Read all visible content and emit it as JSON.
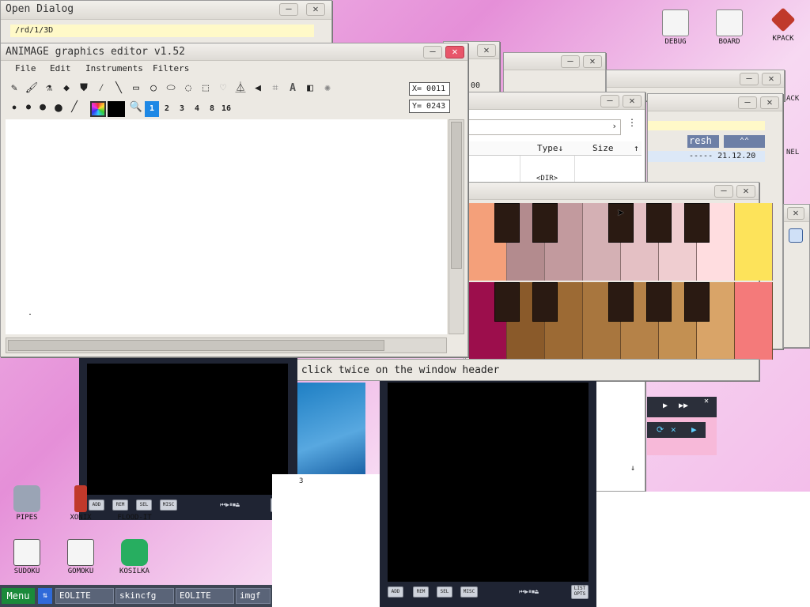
{
  "open_dialog": {
    "title": "Open Dialog",
    "path": "/rd/1/3D"
  },
  "animage": {
    "title": "ANIMAGE graphics editor v1.52",
    "menu": [
      "File",
      "Edit",
      "Instruments",
      "Filters"
    ],
    "x_coord": "X= 0011",
    "y_coord": "Y= 0243",
    "brush_sizes": [
      "1",
      "2",
      "3",
      "4",
      "8",
      "16"
    ],
    "selected_brush_size": "1"
  },
  "file_list": {
    "col_type": "Type",
    "col_size": "Size",
    "row_type": "<DIR>",
    "status_count": "3"
  },
  "right_panel": {
    "refresh_label": "resh",
    "date_text": "----- 21.12.20",
    "date_short": "2.20"
  },
  "piano": {
    "help_text": "To see help click twice on the window header",
    "top_row_colors": [
      "#f4a07a",
      "#b38b8e",
      "#c29a9e",
      "#d4b0b4",
      "#e4c0c4",
      "#efcdd0",
      "#ffdde0",
      "#fde35a"
    ],
    "bottom_row_colors": [
      "#9c0e4c",
      "#8a5a2a",
      "#9c6a34",
      "#a8763e",
      "#b58248",
      "#c39052",
      "#d9a468",
      "#f47a7a"
    ]
  },
  "desktop_icons": [
    {
      "name": "DEBUG",
      "color": "#e8e8e8"
    },
    {
      "name": "BOARD",
      "color": "#e8e8e8"
    },
    {
      "name": "KPACK",
      "color": "#c0392b"
    },
    {
      "name": "PIPES",
      "color": "#9aa4b5"
    },
    {
      "name": "XONIX",
      "color": "#c0392b"
    },
    {
      "name": "FLOOD-IT",
      "color": "#e8e8e8"
    },
    {
      "name": "SUDOKU",
      "color": "#e8e8e8"
    },
    {
      "name": "GOMOKU",
      "color": "#e8e8e8"
    },
    {
      "name": "KOSILKA",
      "color": "#27ae60"
    }
  ],
  "partial_labels": {
    "kpack_right": "ACK",
    "panel_right": "NEL"
  },
  "player": {
    "buttons": [
      "ADD",
      "REM",
      "SEL",
      "MISC"
    ],
    "list_label": "LIST\nOPTS"
  },
  "taskbar": {
    "menu_label": "Menu",
    "tasks": [
      "EOLITE",
      "skincfg",
      "EOLITE",
      "imgf"
    ]
  },
  "partial_window_label": "00"
}
